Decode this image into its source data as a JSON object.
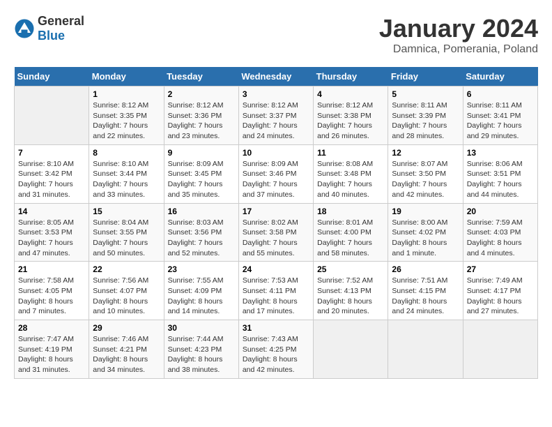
{
  "header": {
    "logo_general": "General",
    "logo_blue": "Blue",
    "title": "January 2024",
    "subtitle": "Damnica, Pomerania, Poland"
  },
  "weekdays": [
    "Sunday",
    "Monday",
    "Tuesday",
    "Wednesday",
    "Thursday",
    "Friday",
    "Saturday"
  ],
  "weeks": [
    [
      {
        "day": "",
        "empty": true
      },
      {
        "day": "1",
        "sunrise": "Sunrise: 8:12 AM",
        "sunset": "Sunset: 3:35 PM",
        "daylight": "Daylight: 7 hours and 22 minutes."
      },
      {
        "day": "2",
        "sunrise": "Sunrise: 8:12 AM",
        "sunset": "Sunset: 3:36 PM",
        "daylight": "Daylight: 7 hours and 23 minutes."
      },
      {
        "day": "3",
        "sunrise": "Sunrise: 8:12 AM",
        "sunset": "Sunset: 3:37 PM",
        "daylight": "Daylight: 7 hours and 24 minutes."
      },
      {
        "day": "4",
        "sunrise": "Sunrise: 8:12 AM",
        "sunset": "Sunset: 3:38 PM",
        "daylight": "Daylight: 7 hours and 26 minutes."
      },
      {
        "day": "5",
        "sunrise": "Sunrise: 8:11 AM",
        "sunset": "Sunset: 3:39 PM",
        "daylight": "Daylight: 7 hours and 28 minutes."
      },
      {
        "day": "6",
        "sunrise": "Sunrise: 8:11 AM",
        "sunset": "Sunset: 3:41 PM",
        "daylight": "Daylight: 7 hours and 29 minutes."
      }
    ],
    [
      {
        "day": "7",
        "sunrise": "Sunrise: 8:10 AM",
        "sunset": "Sunset: 3:42 PM",
        "daylight": "Daylight: 7 hours and 31 minutes."
      },
      {
        "day": "8",
        "sunrise": "Sunrise: 8:10 AM",
        "sunset": "Sunset: 3:44 PM",
        "daylight": "Daylight: 7 hours and 33 minutes."
      },
      {
        "day": "9",
        "sunrise": "Sunrise: 8:09 AM",
        "sunset": "Sunset: 3:45 PM",
        "daylight": "Daylight: 7 hours and 35 minutes."
      },
      {
        "day": "10",
        "sunrise": "Sunrise: 8:09 AM",
        "sunset": "Sunset: 3:46 PM",
        "daylight": "Daylight: 7 hours and 37 minutes."
      },
      {
        "day": "11",
        "sunrise": "Sunrise: 8:08 AM",
        "sunset": "Sunset: 3:48 PM",
        "daylight": "Daylight: 7 hours and 40 minutes."
      },
      {
        "day": "12",
        "sunrise": "Sunrise: 8:07 AM",
        "sunset": "Sunset: 3:50 PM",
        "daylight": "Daylight: 7 hours and 42 minutes."
      },
      {
        "day": "13",
        "sunrise": "Sunrise: 8:06 AM",
        "sunset": "Sunset: 3:51 PM",
        "daylight": "Daylight: 7 hours and 44 minutes."
      }
    ],
    [
      {
        "day": "14",
        "sunrise": "Sunrise: 8:05 AM",
        "sunset": "Sunset: 3:53 PM",
        "daylight": "Daylight: 7 hours and 47 minutes."
      },
      {
        "day": "15",
        "sunrise": "Sunrise: 8:04 AM",
        "sunset": "Sunset: 3:55 PM",
        "daylight": "Daylight: 7 hours and 50 minutes."
      },
      {
        "day": "16",
        "sunrise": "Sunrise: 8:03 AM",
        "sunset": "Sunset: 3:56 PM",
        "daylight": "Daylight: 7 hours and 52 minutes."
      },
      {
        "day": "17",
        "sunrise": "Sunrise: 8:02 AM",
        "sunset": "Sunset: 3:58 PM",
        "daylight": "Daylight: 7 hours and 55 minutes."
      },
      {
        "day": "18",
        "sunrise": "Sunrise: 8:01 AM",
        "sunset": "Sunset: 4:00 PM",
        "daylight": "Daylight: 7 hours and 58 minutes."
      },
      {
        "day": "19",
        "sunrise": "Sunrise: 8:00 AM",
        "sunset": "Sunset: 4:02 PM",
        "daylight": "Daylight: 8 hours and 1 minute."
      },
      {
        "day": "20",
        "sunrise": "Sunrise: 7:59 AM",
        "sunset": "Sunset: 4:03 PM",
        "daylight": "Daylight: 8 hours and 4 minutes."
      }
    ],
    [
      {
        "day": "21",
        "sunrise": "Sunrise: 7:58 AM",
        "sunset": "Sunset: 4:05 PM",
        "daylight": "Daylight: 8 hours and 7 minutes."
      },
      {
        "day": "22",
        "sunrise": "Sunrise: 7:56 AM",
        "sunset": "Sunset: 4:07 PM",
        "daylight": "Daylight: 8 hours and 10 minutes."
      },
      {
        "day": "23",
        "sunrise": "Sunrise: 7:55 AM",
        "sunset": "Sunset: 4:09 PM",
        "daylight": "Daylight: 8 hours and 14 minutes."
      },
      {
        "day": "24",
        "sunrise": "Sunrise: 7:53 AM",
        "sunset": "Sunset: 4:11 PM",
        "daylight": "Daylight: 8 hours and 17 minutes."
      },
      {
        "day": "25",
        "sunrise": "Sunrise: 7:52 AM",
        "sunset": "Sunset: 4:13 PM",
        "daylight": "Daylight: 8 hours and 20 minutes."
      },
      {
        "day": "26",
        "sunrise": "Sunrise: 7:51 AM",
        "sunset": "Sunset: 4:15 PM",
        "daylight": "Daylight: 8 hours and 24 minutes."
      },
      {
        "day": "27",
        "sunrise": "Sunrise: 7:49 AM",
        "sunset": "Sunset: 4:17 PM",
        "daylight": "Daylight: 8 hours and 27 minutes."
      }
    ],
    [
      {
        "day": "28",
        "sunrise": "Sunrise: 7:47 AM",
        "sunset": "Sunset: 4:19 PM",
        "daylight": "Daylight: 8 hours and 31 minutes."
      },
      {
        "day": "29",
        "sunrise": "Sunrise: 7:46 AM",
        "sunset": "Sunset: 4:21 PM",
        "daylight": "Daylight: 8 hours and 34 minutes."
      },
      {
        "day": "30",
        "sunrise": "Sunrise: 7:44 AM",
        "sunset": "Sunset: 4:23 PM",
        "daylight": "Daylight: 8 hours and 38 minutes."
      },
      {
        "day": "31",
        "sunrise": "Sunrise: 7:43 AM",
        "sunset": "Sunset: 4:25 PM",
        "daylight": "Daylight: 8 hours and 42 minutes."
      },
      {
        "day": "",
        "empty": true
      },
      {
        "day": "",
        "empty": true
      },
      {
        "day": "",
        "empty": true
      }
    ]
  ]
}
